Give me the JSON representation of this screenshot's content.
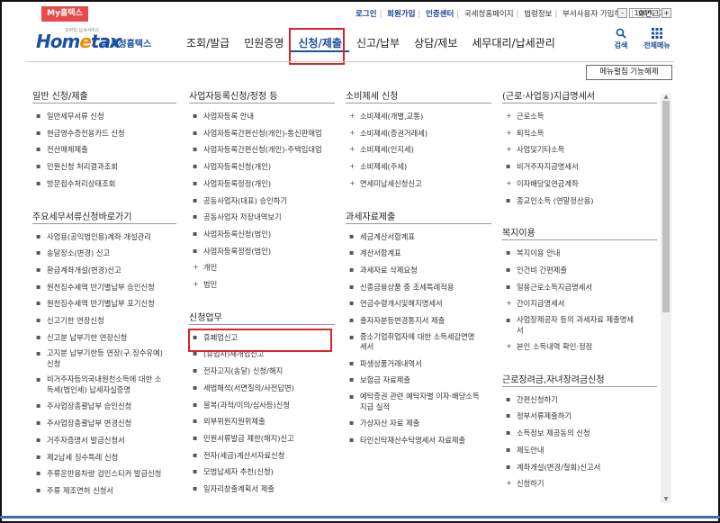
{
  "my_hometax": "My홈택스",
  "util_links": [
    "로그인",
    "회원가입",
    "인증센터",
    "국세청홈페이지",
    "법령정보",
    "부서사용자 가입하기",
    "화면크기"
  ],
  "zoom": {
    "value": "100%",
    "minus": "-",
    "plus": "+"
  },
  "logo": {
    "brand": "Hometax",
    "sub": "국세청홈택스",
    "tagline": "모바일 납세서비스"
  },
  "gnb": [
    "조회/발급",
    "민원증명",
    "신청/제출",
    "신고/납부",
    "상담/제보",
    "세무대리/납세관리"
  ],
  "search_label": "검색",
  "menu_label": "전체메뉴",
  "toggle_label": "메뉴펼침 기능해제",
  "columns": [
    {
      "sections": [
        {
          "title": "일반 신청/제출",
          "items": [
            {
              "text": "일반세무서류 신청",
              "b": "▪"
            },
            {
              "text": "현금영수증전용카드 신청",
              "b": "▪"
            },
            {
              "text": "전산매체제출",
              "b": "▪"
            },
            {
              "text": "민원신청 처리결과조회",
              "b": "▪"
            },
            {
              "text": "방문접수처리상태조회",
              "b": "▪"
            }
          ]
        },
        {
          "title": "주요세무서류신청바로가기",
          "items": [
            {
              "text": "사업용(공익법인용)계좌 개설관리",
              "b": "▪"
            },
            {
              "text": "송달장소(변경) 신고",
              "b": "▪"
            },
            {
              "text": "환급계좌개설(변경)신고",
              "b": "▪"
            },
            {
              "text": "원천징수세액 반기별납부 승인신청",
              "b": "▪"
            },
            {
              "text": "원천징수세액 반기별납부 포기신청",
              "b": "▪"
            },
            {
              "text": "신고기한 연장신청",
              "b": "▪"
            },
            {
              "text": "신고분 납부기한 연장신청",
              "b": "▪"
            },
            {
              "text": "고지분 납부기한등 연장(구.징수유예)\n신청",
              "b": "▪",
              "multi": true
            },
            {
              "text": "비거주자등의국내원천소득에 대한 소\n득세(법인세) 납세자실증명",
              "b": "▪",
              "multi": true
            },
            {
              "text": "주사업장총괄납부 승인신청",
              "b": "▪"
            },
            {
              "text": "주사업장총괄납부 변경신청",
              "b": "▪"
            },
            {
              "text": "거주자증명서 발급신청서",
              "b": "▪"
            },
            {
              "text": "제2납세 징수특례 신청",
              "b": "▪"
            },
            {
              "text": "주류운반용차량 검인스티커 발급신청",
              "b": "▪"
            },
            {
              "text": "주류 제조면허 신청서",
              "b": "▪"
            }
          ]
        }
      ]
    },
    {
      "sections": [
        {
          "title": "사업자등록신청/정정 등",
          "items": [
            {
              "text": "사업자등록 안내",
              "b": "▪"
            },
            {
              "text": "사업자등록간편신청(개인)-통신판매업",
              "b": "▪"
            },
            {
              "text": "사업자등록간편신청(개인)-주택임대업",
              "b": "▪"
            },
            {
              "text": "사업자등록신청(개인)",
              "b": "▪"
            },
            {
              "text": "사업자등록정정(개인)",
              "b": "▪"
            },
            {
              "text": "공동사업자(대표) 승인하기",
              "b": "▪"
            },
            {
              "text": "공동사업자 저장내역보기",
              "b": "▪"
            },
            {
              "text": "사업자등록신청(법인)",
              "b": "▪"
            },
            {
              "text": "사업자등록정정(법인)",
              "b": "▪"
            },
            {
              "text": "개인",
              "b": "+"
            },
            {
              "text": "법인",
              "b": "+"
            }
          ]
        },
        {
          "title": "신청업무",
          "items": [
            {
              "text": "휴폐업신고",
              "b": "▪"
            },
            {
              "text": "(휴업자)재개업신고",
              "b": "▪"
            },
            {
              "text": "전자고지(송달) 신청/해지",
              "b": "▪"
            },
            {
              "text": "세법해석(서면질의/사전답변)",
              "b": "▪"
            },
            {
              "text": "불복(과적/이의/심사등)신청",
              "b": "▪"
            },
            {
              "text": "외부위원지원위제출",
              "b": "▪"
            },
            {
              "text": "민원서류발급 제한(해지)신고",
              "b": "▪"
            },
            {
              "text": "전자(세금)계산서자료신청",
              "b": "▪"
            },
            {
              "text": "모범납세자 추천(신청)",
              "b": "▪"
            },
            {
              "text": "일자리창출계획서 제출",
              "b": "▪"
            }
          ]
        }
      ]
    },
    {
      "sections": [
        {
          "title": "소비제세 신청",
          "items": [
            {
              "text": "소비제세(개별,교통)",
              "b": "+"
            },
            {
              "text": "소비제세(증권거래세)",
              "b": "+"
            },
            {
              "text": "소비제세(인지세)",
              "b": "+"
            },
            {
              "text": "소비제세(주세)",
              "b": "+"
            },
            {
              "text": "면세미납세신청신고",
              "b": "+"
            }
          ]
        },
        {
          "title": "과세자료제출",
          "items": [
            {
              "text": "세금계산서합계표",
              "b": "▪"
            },
            {
              "text": "계산서합계표",
              "b": "▪"
            },
            {
              "text": "과세자료 삭제요청",
              "b": "▪"
            },
            {
              "text": "신종금융상품 중 조세특례적용",
              "b": "▪"
            },
            {
              "text": "연금수령개시및해지명세서",
              "b": "▪"
            },
            {
              "text": "출자자분등변경통지서 제출",
              "b": "▪"
            },
            {
              "text": "중소기업취업자에 대한 소득세감면명\n세서",
              "b": "▪",
              "multi": true
            },
            {
              "text": "파생상품거래내역서",
              "b": "▪"
            },
            {
              "text": "보험금 자료제출",
              "b": "▪"
            },
            {
              "text": "예탁증권 관련 예탁자별 이자·배당소득\n지급 실적",
              "b": "▪",
              "multi": true
            },
            {
              "text": "가상자산 자료 제출",
              "b": "▪"
            },
            {
              "text": "타인신탁재산수탁명세서 자료제출",
              "b": "▪"
            }
          ]
        }
      ]
    },
    {
      "sections": [
        {
          "title": "(근로·사업등)지급명세서",
          "items": [
            {
              "text": "근로소득",
              "b": "+"
            },
            {
              "text": "퇴직소득",
              "b": "+"
            },
            {
              "text": "사업및기타소득",
              "b": "+"
            },
            {
              "text": "비거주자지급명세서",
              "b": "▪"
            },
            {
              "text": "이자배당및연금계좌",
              "b": "+"
            },
            {
              "text": "종교인소득 (연말정산용)",
              "b": "▪"
            }
          ]
        },
        {
          "title": "복지이용",
          "items": [
            {
              "text": "복지이용 안내",
              "b": "▪"
            },
            {
              "text": "인건비 간편제출",
              "b": "▪"
            },
            {
              "text": "일용근로소득지급명세서",
              "b": "▪"
            },
            {
              "text": "간이지급명세서",
              "b": "+"
            },
            {
              "text": "사업장제공자 등의 과세자료 제출명세\n서",
              "b": "▪",
              "multi": true
            },
            {
              "text": "본인 소득내역 확인·정정",
              "b": "+"
            }
          ]
        },
        {
          "title": "근로장려금,자녀장려금신청",
          "items": [
            {
              "text": "간편신청하기",
              "b": "▪"
            },
            {
              "text": "정부서류제출하기",
              "b": "▪"
            },
            {
              "text": "소득정보 제공동의 신청",
              "b": "▪"
            },
            {
              "text": "제도안내",
              "b": "▪"
            },
            {
              "text": "계좌개설(변경/철회)신고서",
              "b": "▪"
            },
            {
              "text": "신청하기",
              "b": "+"
            }
          ]
        }
      ]
    }
  ]
}
